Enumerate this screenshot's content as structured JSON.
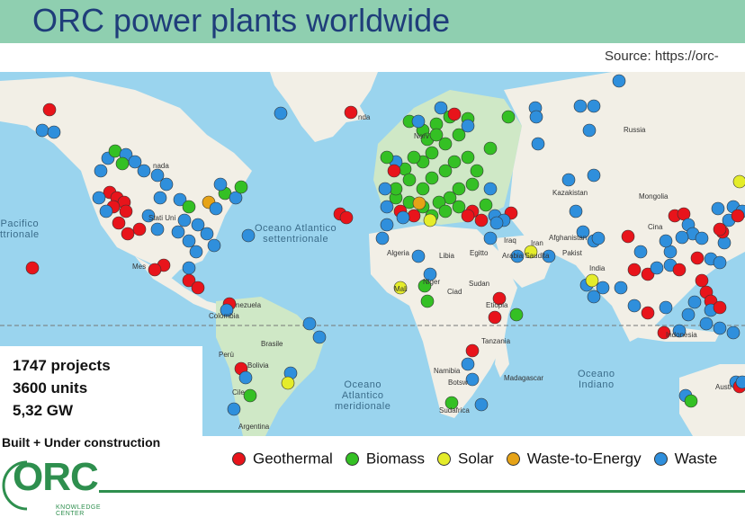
{
  "title": "ORC power plants worldwide",
  "source": "Source: https://orc-",
  "stats": {
    "projects": "1747 projects",
    "units": "3600 units",
    "capacity": "5,32 GW"
  },
  "built_label": "Built + Under construction",
  "legend": [
    {
      "label": "Geothermal",
      "color": "#e8141b"
    },
    {
      "label": "Biomass",
      "color": "#34c024"
    },
    {
      "label": "Solar",
      "color": "#e4ec2a"
    },
    {
      "label": "Waste-to-Energy",
      "color": "#e6a317"
    },
    {
      "label": "Waste",
      "color": "#2f8fdc"
    }
  ],
  "logo": {
    "text": "ORC",
    "subtitle": "KNOWLEDGE CENTER"
  },
  "map": {
    "colors": {
      "ocean": "#9ad4ee",
      "land": "#f2efe6",
      "green_land": "#cfe8c6"
    },
    "labels": {
      "oceans": {
        "pacific": "Pacifico\nttrionale",
        "atlantic_n": "Oceano Atlantico\nsettentrionale",
        "atlantic_s": "Oceano\nAtlantico\nmeridionale",
        "indian": "Oceano\nIndiano"
      },
      "countries": [
        "nda",
        "nada",
        "Stati Uni",
        "Mes",
        "nezuela",
        "Colombia",
        "Brasile",
        "Perù",
        "Bolivia",
        "Cile",
        "Argentina",
        "Norv",
        "Algeria",
        "Libia",
        "Egitto",
        "Mali",
        "Niger",
        "Ciad",
        "Sudan",
        "Etiopia",
        "Tanzania",
        "Namibia",
        "Botsw",
        "Madagascar",
        "Sudafrica",
        "Iraq",
        "Iran",
        "Arabia Saudita",
        "Kazakistan",
        "Mongolia",
        "Afghanistan",
        "Pakist",
        "India",
        "Cina",
        "Russia",
        "Indonesia",
        "Austr"
      ]
    }
  }
}
